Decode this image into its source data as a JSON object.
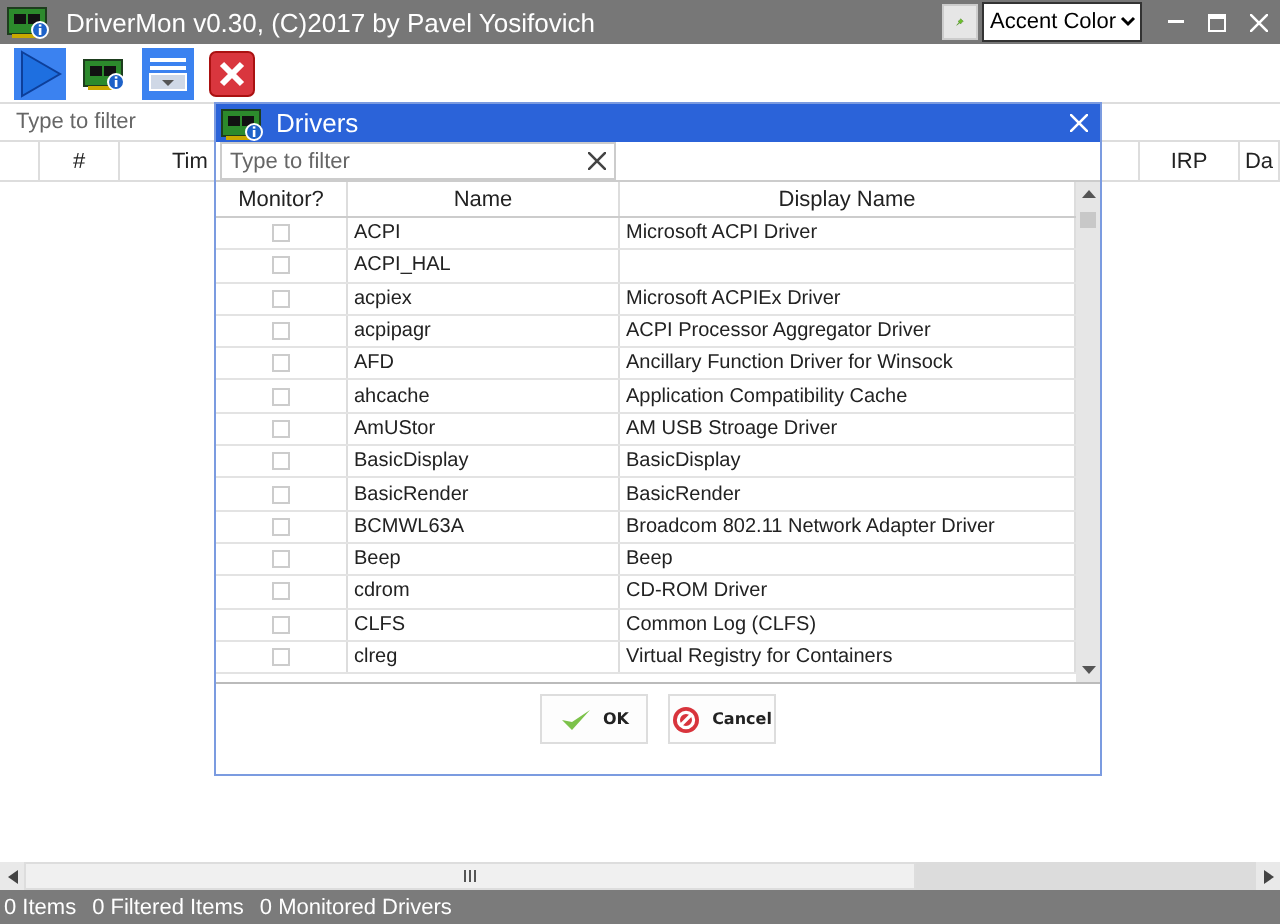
{
  "window": {
    "title": "DriverMon v0.30, (C)2017 by Pavel Yosifovich",
    "theme_select": "Accent Color"
  },
  "toolbar": [
    {
      "kind": "start",
      "active": true
    },
    {
      "kind": "drivers",
      "active": false
    },
    {
      "kind": "list",
      "active": true
    },
    {
      "kind": "stop",
      "active": false
    }
  ],
  "filter": {
    "placeholder": "Type to filter"
  },
  "columns": [
    "#",
    "Tim",
    "IRP",
    "Da"
  ],
  "status_bar": [
    "0 Items",
    "0 Filtered Items",
    "0 Monitored Drivers"
  ],
  "dialog": {
    "title": "Drivers",
    "filter": {
      "placeholder": "Type to filter"
    },
    "columns": [
      "Monitor?",
      "Name",
      "Display Name"
    ],
    "rows": [
      {
        "monitor": false,
        "name": "ACPI",
        "display_name": "Microsoft ACPI Driver"
      },
      {
        "monitor": false,
        "name": "ACPI_HAL"
      },
      {
        "monitor": false,
        "name": "acpiex",
        "display_name": "Microsoft ACPIEx Driver"
      },
      {
        "monitor": false,
        "name": "acpipagr",
        "display_name": "ACPI Processor Aggregator Driver"
      },
      {
        "monitor": false,
        "name": "AFD",
        "display_name": "Ancillary Function Driver for Winsock"
      },
      {
        "monitor": false,
        "name": "ahcache",
        "display_name": "Application Compatibility Cache"
      },
      {
        "monitor": false,
        "name": "AmUStor",
        "display_name": "AM USB Stroage Driver"
      },
      {
        "monitor": false,
        "name": "BasicDisplay",
        "display_name": "BasicDisplay"
      },
      {
        "monitor": false,
        "name": "BasicRender",
        "display_name": "BasicRender"
      },
      {
        "monitor": false,
        "name": "BCMWL63A",
        "display_name": "Broadcom 802.11 Network Adapter Driver"
      },
      {
        "monitor": false,
        "name": "Beep",
        "display_name": "Beep"
      },
      {
        "monitor": false,
        "name": "cdrom",
        "display_name": "CD-ROM Driver"
      },
      {
        "monitor": false,
        "name": "CLFS",
        "display_name": "Common Log (CLFS)"
      },
      {
        "monitor": false,
        "name": "clreg",
        "display_name": "Virtual Registry for Containers"
      }
    ],
    "buttons": [
      {
        "kind": "ok",
        "label": "OK"
      },
      {
        "kind": "cancel",
        "label": "Cancel"
      }
    ]
  }
}
